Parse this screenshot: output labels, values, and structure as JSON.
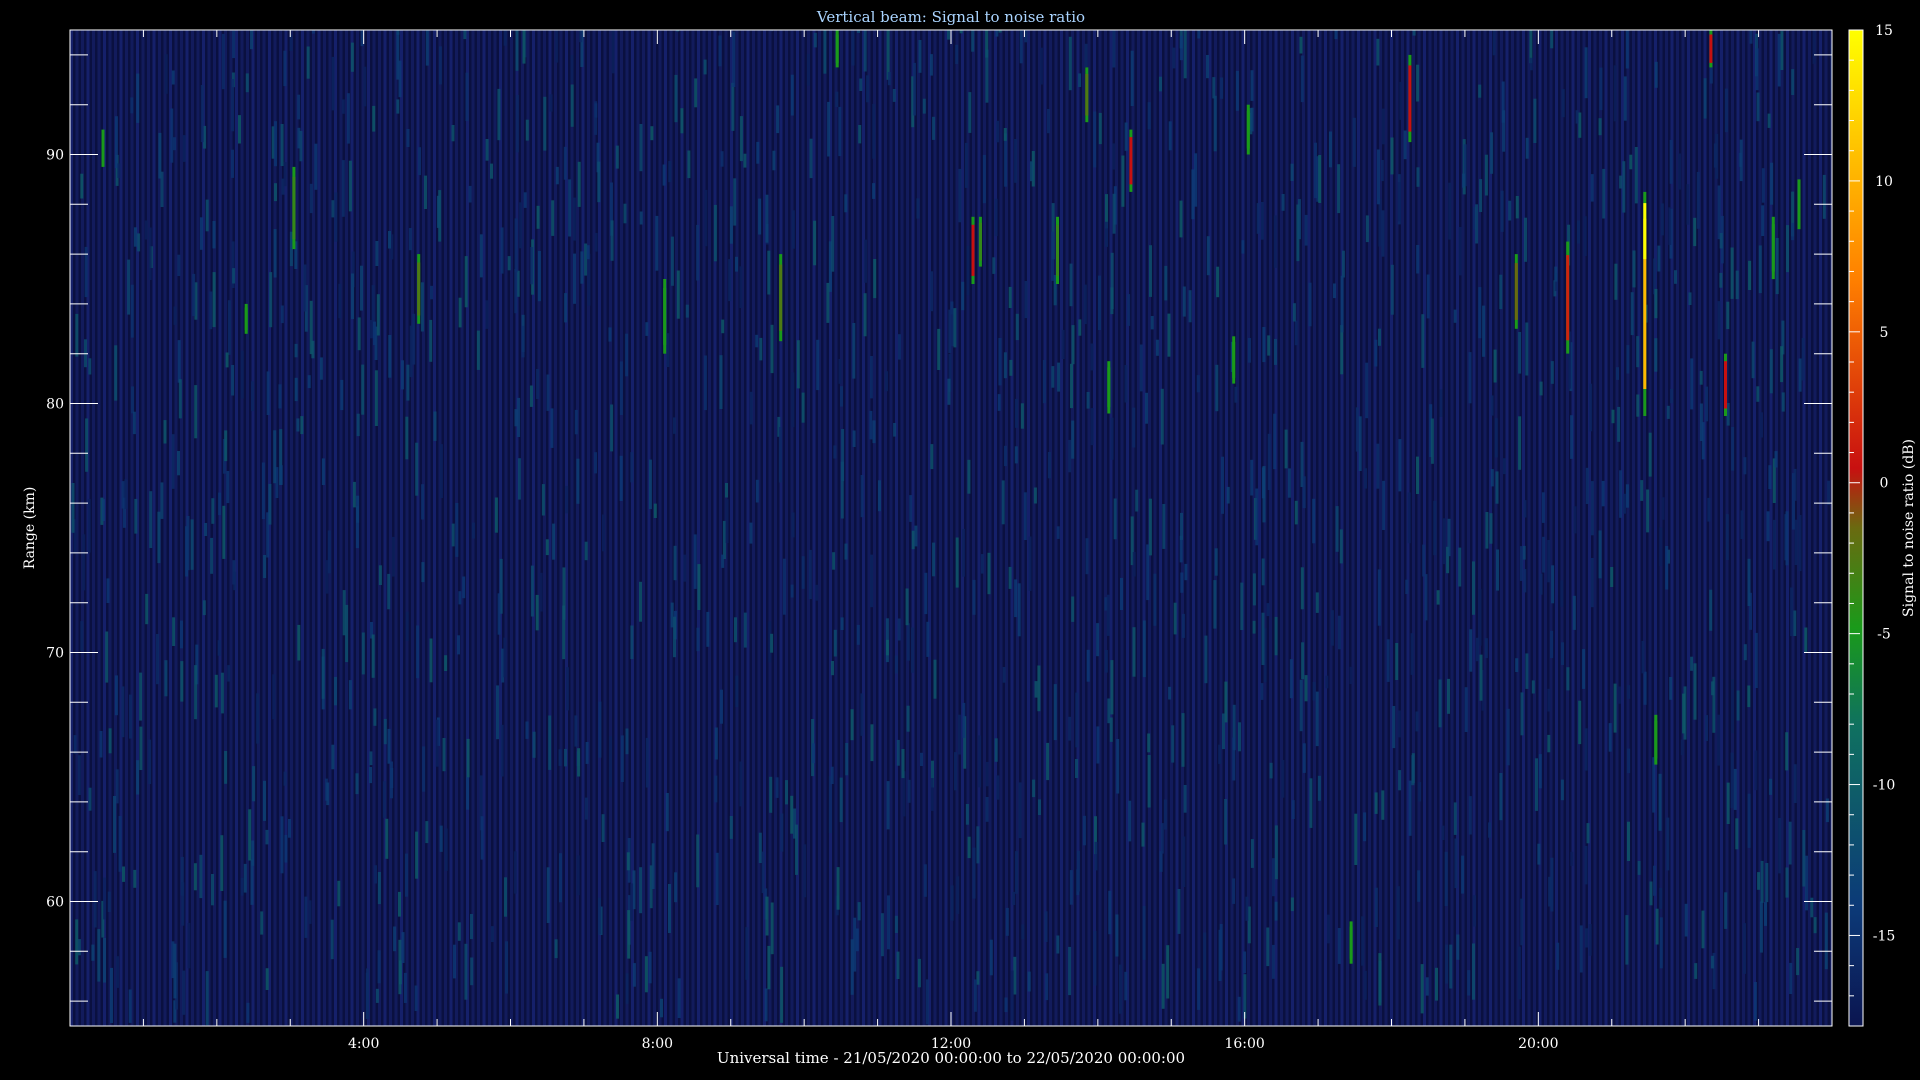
{
  "chart_data": {
    "type": "heatmap",
    "title": "Vertical beam: Signal to noise ratio",
    "xlabel": "Universal time - 21/05/2020 00:00:00 to 22/05/2020 00:00:00",
    "ylabel": "Range (km)",
    "x_unit": "hours UT",
    "xlim": [
      0,
      24
    ],
    "ylim": [
      55,
      95
    ],
    "x_ticks": [
      {
        "value": 4,
        "label": "4:00"
      },
      {
        "value": 8,
        "label": "8:00"
      },
      {
        "value": 12,
        "label": "12:00"
      },
      {
        "value": 16,
        "label": "16:00"
      },
      {
        "value": 20,
        "label": "20:00"
      }
    ],
    "y_ticks": [
      {
        "value": 60,
        "label": "60"
      },
      {
        "value": 70,
        "label": "70"
      },
      {
        "value": 80,
        "label": "80"
      },
      {
        "value": 90,
        "label": "90"
      }
    ],
    "colorbar": {
      "label": "Signal to noise ratio (dB)",
      "range": [
        -18,
        15
      ],
      "ticks": [
        {
          "value": -15,
          "label": "-15"
        },
        {
          "value": -10,
          "label": "-10"
        },
        {
          "value": -5,
          "label": "-5"
        },
        {
          "value": 0,
          "label": "0"
        },
        {
          "value": 5,
          "label": "5"
        },
        {
          "value": 10,
          "label": "10"
        },
        {
          "value": 15,
          "label": "15"
        }
      ],
      "colors": [
        "#0b1550",
        "#0c3a78",
        "#0f7060",
        "#1a9a1a",
        "#6a6a10",
        "#c81010",
        "#ff8000",
        "#ffff00"
      ]
    },
    "background_snr": -16,
    "echoes": [
      {
        "t": 0.45,
        "r0": 89.5,
        "r1": 91.0,
        "snr": -5
      },
      {
        "t": 2.4,
        "r0": 82.8,
        "r1": 84.0,
        "snr": -5
      },
      {
        "t": 3.05,
        "r0": 86.2,
        "r1": 89.5,
        "snr": -4
      },
      {
        "t": 4.75,
        "r0": 83.2,
        "r1": 86.0,
        "snr": -3
      },
      {
        "t": 8.1,
        "r0": 82.0,
        "r1": 85.0,
        "snr": -5
      },
      {
        "t": 9.68,
        "r0": 82.5,
        "r1": 86.0,
        "snr": -3
      },
      {
        "t": 10.45,
        "r0": 93.5,
        "r1": 95.0,
        "snr": -5
      },
      {
        "t": 12.3,
        "r0": 84.8,
        "r1": 87.5,
        "snr": 0
      },
      {
        "t": 12.4,
        "r0": 85.5,
        "r1": 87.5,
        "snr": -4
      },
      {
        "t": 13.45,
        "r0": 84.8,
        "r1": 87.5,
        "snr": -4
      },
      {
        "t": 13.85,
        "r0": 91.3,
        "r1": 93.5,
        "snr": -3
      },
      {
        "t": 14.15,
        "r0": 79.6,
        "r1": 81.7,
        "snr": -5
      },
      {
        "t": 14.45,
        "r0": 88.5,
        "r1": 91.0,
        "snr": 0
      },
      {
        "t": 15.85,
        "r0": 80.8,
        "r1": 82.7,
        "snr": -5
      },
      {
        "t": 16.05,
        "r0": 90.0,
        "r1": 92.0,
        "snr": -5
      },
      {
        "t": 17.45,
        "r0": 57.5,
        "r1": 59.2,
        "snr": -5
      },
      {
        "t": 18.25,
        "r0": 90.5,
        "r1": 94.0,
        "snr": 0
      },
      {
        "t": 19.7,
        "r0": 83.0,
        "r1": 86.0,
        "snr": -2
      },
      {
        "t": 20.4,
        "r0": 82.0,
        "r1": 86.5,
        "snr": 1
      },
      {
        "t": 21.45,
        "r0": 79.5,
        "r1": 88.5,
        "snr": 10
      },
      {
        "t": 21.6,
        "r0": 65.5,
        "r1": 67.5,
        "snr": -5
      },
      {
        "t": 22.35,
        "r0": 93.5,
        "r1": 95.0,
        "snr": 0
      },
      {
        "t": 22.55,
        "r0": 79.5,
        "r1": 82.0,
        "snr": 0
      },
      {
        "t": 23.2,
        "r0": 85.0,
        "r1": 87.5,
        "snr": -5
      },
      {
        "t": 23.55,
        "r0": 87.0,
        "r1": 89.0,
        "snr": -5
      }
    ]
  }
}
